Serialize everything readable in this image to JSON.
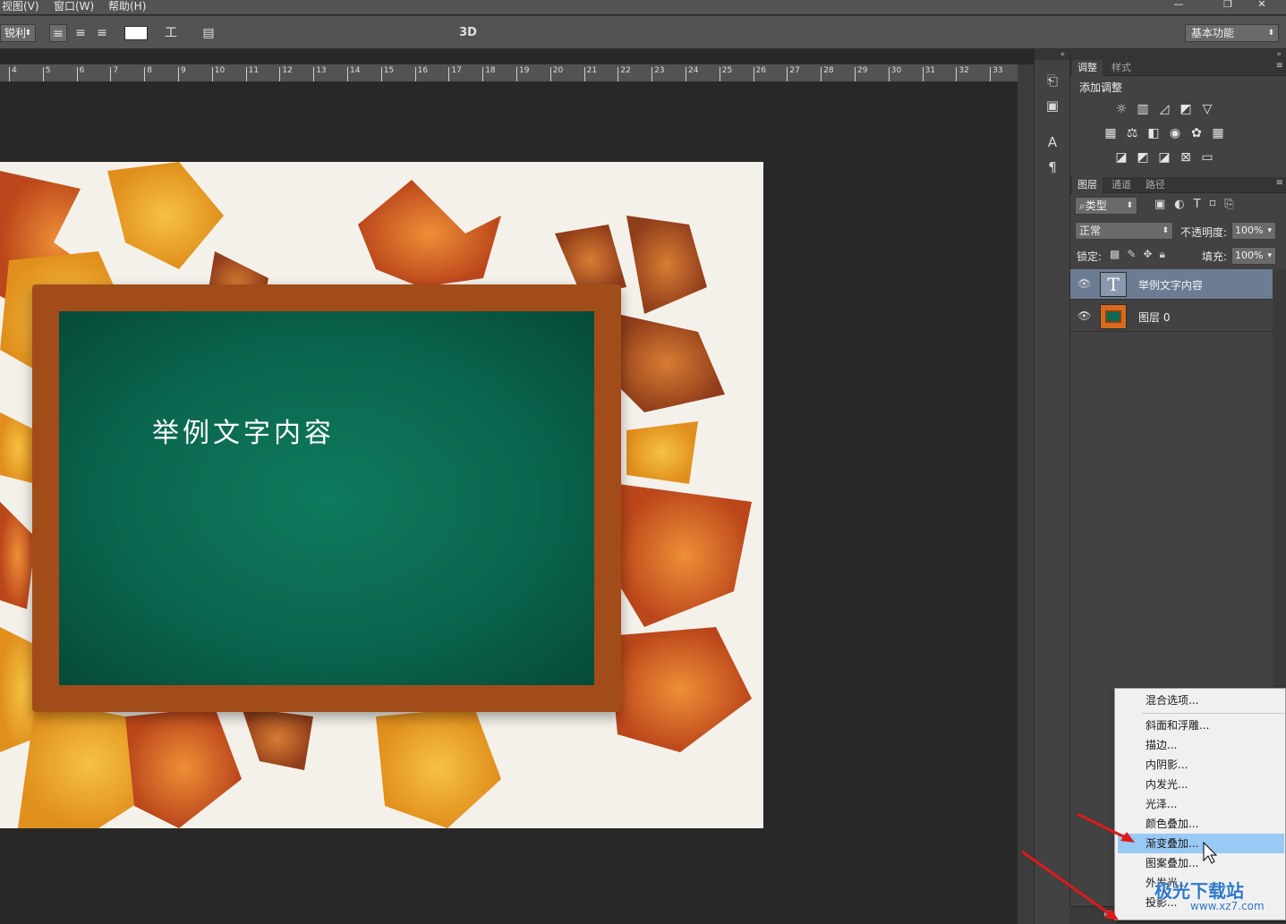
{
  "menubar": {
    "items": [
      "视图(V)",
      "窗口(W)",
      "帮助(H)"
    ],
    "window_controls": [
      "—",
      "❐",
      "✕"
    ]
  },
  "options": {
    "font_style": "锐利",
    "threeD": "3D",
    "workspace": "基本功能"
  },
  "ruler": {
    "labels": [
      "4",
      "5",
      "6",
      "7",
      "8",
      "9",
      "10",
      "11",
      "12",
      "13",
      "14",
      "15",
      "16",
      "17",
      "18",
      "19",
      "20",
      "21",
      "22",
      "23",
      "24",
      "25",
      "26",
      "27",
      "28",
      "29",
      "30",
      "31",
      "32",
      "33"
    ]
  },
  "canvas": {
    "text_layer_content": "举例文字内容"
  },
  "adjust_panel": {
    "tabs": [
      "调整",
      "样式"
    ],
    "title": "添加调整"
  },
  "layers_panel": {
    "tabs": [
      "图层",
      "通道",
      "路径"
    ],
    "filter_kind": "类型",
    "blend_mode": "正常",
    "opacity_label": "不透明度:",
    "opacity_value": "100%",
    "lock_label": "锁定:",
    "fill_label": "填充:",
    "fill_value": "100%",
    "layers": [
      {
        "name": "举例文字内容",
        "type": "text",
        "selected": true
      },
      {
        "name": "图层 0",
        "type": "image",
        "selected": false
      }
    ]
  },
  "context_menu": {
    "items": [
      "混合选项...",
      "斜面和浮雕...",
      "描边...",
      "内阴影...",
      "内发光...",
      "光泽...",
      "颜色叠加...",
      "渐变叠加...",
      "图案叠加...",
      "外发光...",
      "投影..."
    ],
    "highlighted": "渐变叠加..."
  },
  "watermark": {
    "name": "极光下载站",
    "url": "www.xz7.com"
  },
  "colors": {
    "highlight": "#99c9f5",
    "selected_layer": "#6c7c93",
    "board_green": "#0a664e",
    "frame_wood": "#a24d19"
  }
}
